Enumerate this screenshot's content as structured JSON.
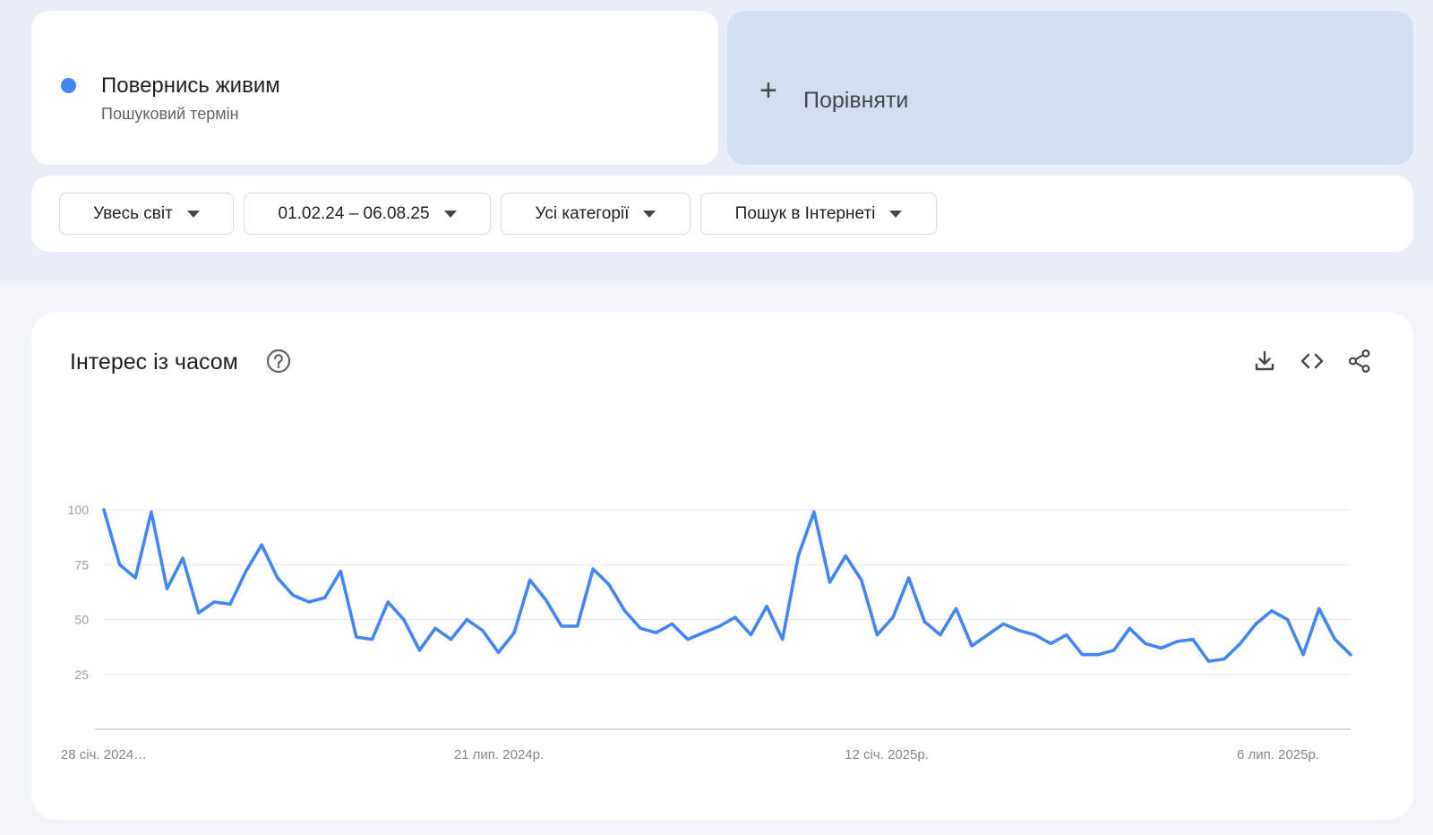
{
  "term": {
    "name": "Повернись живим",
    "subtitle": "Пошуковий термін",
    "color": "#4285f4"
  },
  "compare": {
    "label": "Порівняти"
  },
  "filters": [
    {
      "label": "Увесь світ"
    },
    {
      "label": "01.02.24 – 06.08.25"
    },
    {
      "label": "Усі категорії"
    },
    {
      "label": "Пошук в Інтернеті"
    }
  ],
  "chart_panel": {
    "title": "Інтерес із часом",
    "icons": [
      "help-icon",
      "download-icon",
      "embed-code-icon",
      "share-icon"
    ]
  },
  "chart_data": {
    "type": "line",
    "title": "",
    "xlabel": "",
    "ylabel": "",
    "ylim": [
      0,
      100
    ],
    "y_ticks": [
      25,
      50,
      75,
      100
    ],
    "x_tick_labels": [
      "28 січ. 2024…",
      "21 лип. 2024р.",
      "12 січ. 2025р.",
      "6 лип. 2025р."
    ],
    "grid": true,
    "line_color": "#4285f4",
    "series": [
      {
        "values": [
          100,
          75,
          69,
          99,
          64,
          78,
          53,
          58,
          57,
          72,
          84,
          69,
          61,
          58,
          60,
          72,
          42,
          41,
          58,
          50,
          36,
          46,
          41,
          50,
          45,
          35,
          44,
          68,
          59,
          47,
          47,
          73,
          66,
          54,
          46,
          44,
          48,
          41,
          44,
          47,
          51,
          43,
          56,
          41,
          79,
          99,
          67,
          79,
          68,
          43,
          51,
          69,
          49,
          43,
          55,
          38,
          43,
          48,
          45,
          43,
          39,
          43,
          34,
          34,
          36,
          46,
          39,
          37,
          40,
          41,
          31,
          32,
          39,
          48,
          54,
          50,
          34,
          55,
          41,
          34
        ]
      }
    ]
  }
}
